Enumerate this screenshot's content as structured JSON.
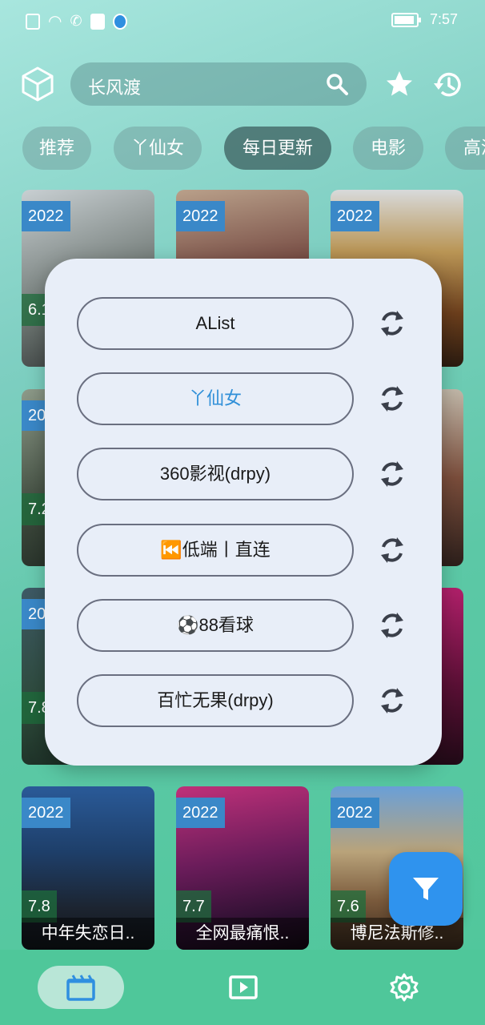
{
  "status_bar": {
    "time": "7:57"
  },
  "search": {
    "query": "长风渡"
  },
  "tabs": [
    {
      "label": "推荐"
    },
    {
      "label": "丫仙女"
    },
    {
      "label": "每日更新",
      "active": true
    },
    {
      "label": "电影"
    },
    {
      "label": "高清"
    }
  ],
  "cards": [
    {
      "year": "2022",
      "score": "6.1",
      "title": ""
    },
    {
      "year": "2022",
      "score": "",
      "title": ""
    },
    {
      "year": "2022",
      "score": "",
      "title": ""
    },
    {
      "year": "20",
      "score": "7.2",
      "title": ""
    },
    {
      "year": "",
      "score": "",
      "title": ""
    },
    {
      "year": "",
      "score": "",
      "title": ""
    },
    {
      "year": "20",
      "score": "7.8",
      "title": ""
    },
    {
      "year": "",
      "score": "",
      "title": ""
    },
    {
      "year": "",
      "score": "",
      "title": ""
    },
    {
      "year": "2022",
      "score": "7.8",
      "title": "中年失恋日.."
    },
    {
      "year": "2022",
      "score": "7.7",
      "title": "全网最痛恨.."
    },
    {
      "year": "2022",
      "score": "7.6",
      "title": "博尼法斯修.."
    }
  ],
  "sources": [
    {
      "label": "AList"
    },
    {
      "label": "丫仙女",
      "selected": true
    },
    {
      "label": "360影视(drpy)"
    },
    {
      "label": "⏮️低端丨直连"
    },
    {
      "label": "⚽88看球"
    },
    {
      "label": "百忙无果(drpy)"
    }
  ],
  "icons": {
    "app_logo": "cube-icon",
    "search": "search-icon",
    "favorite": "star-icon",
    "history": "history-icon",
    "filter": "filter-icon",
    "refresh": "refresh-icon",
    "nav_home": "film-icon",
    "nav_player": "play-icon",
    "nav_settings": "gear-icon"
  },
  "colors": {
    "accent": "#2f93ee",
    "selected_source": "#2f8fd8"
  }
}
